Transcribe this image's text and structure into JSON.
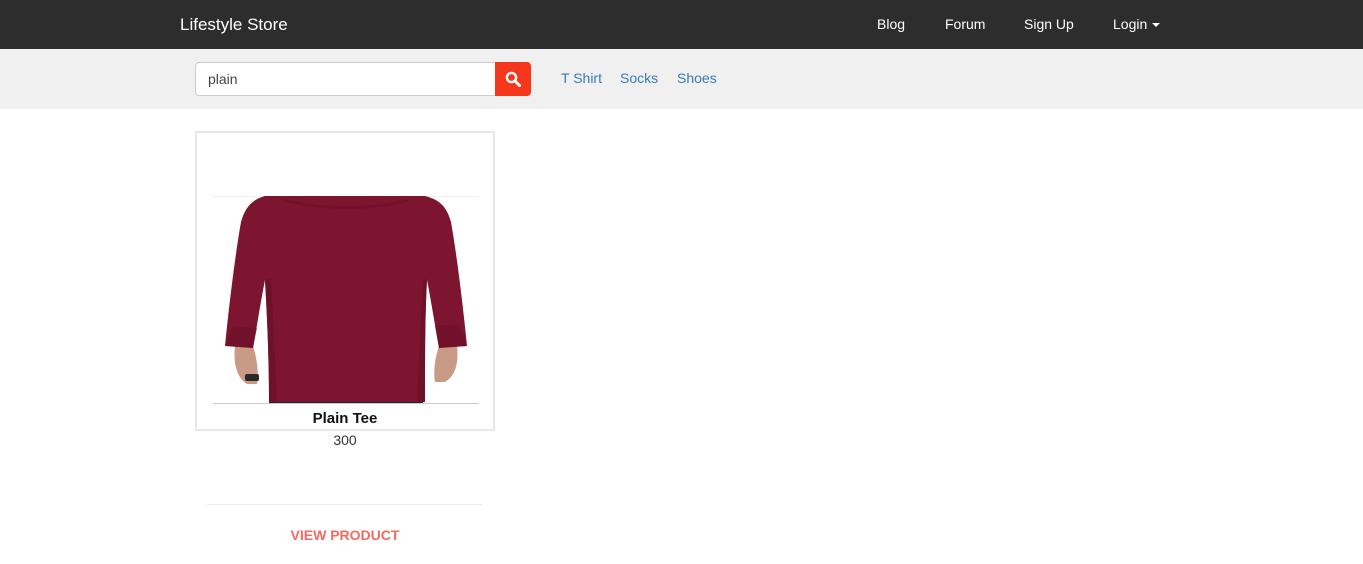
{
  "navbar": {
    "brand": "Lifestyle Store",
    "links": [
      "Blog",
      "Forum",
      "Sign Up",
      "Login"
    ]
  },
  "search": {
    "value": "plain",
    "button_icon": "search-icon"
  },
  "categories": [
    "T Shirt",
    "Socks",
    "Shoes"
  ],
  "product": {
    "name": "Plain Tee",
    "price": "300",
    "action_label": "VIEW PRODUCT",
    "image": "maroon-long-sleeve-tee"
  },
  "colors": {
    "navbar_bg": "#2d2d2d",
    "subbar_bg": "#f0f0f0",
    "search_button": "#f5371c",
    "category_link": "#3b7ab8",
    "view_product": "#f26a62",
    "tee": "#7e1530"
  }
}
